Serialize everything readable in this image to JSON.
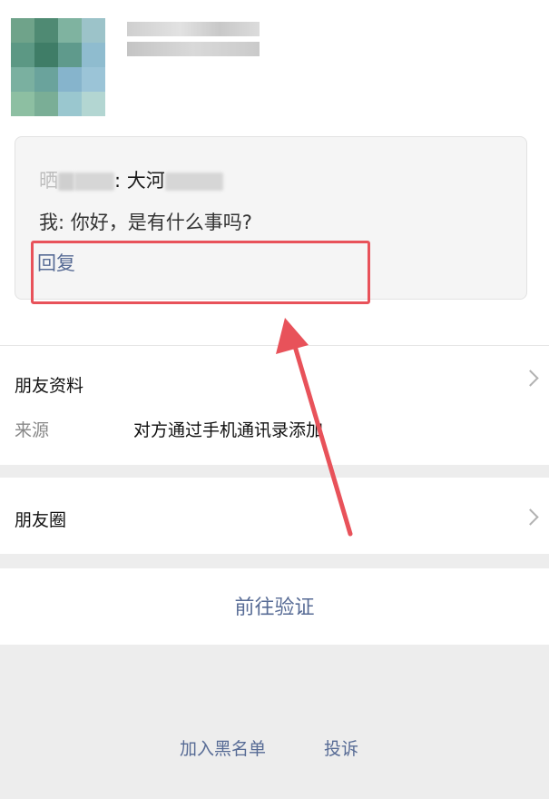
{
  "message": {
    "line1_prefix": "晒",
    "line1_name": "大河",
    "line2": "我: 你好，是有什么事吗?",
    "reply_label": "回复"
  },
  "friend_info": {
    "title": "朋友资料",
    "source_label": "来源",
    "source_value": "对方通过手机通讯录添加"
  },
  "moments": {
    "title": "朋友圈"
  },
  "actions": {
    "verify_label": "前往验证",
    "blacklist_label": "加入黑名单",
    "report_label": "投诉"
  },
  "colors": {
    "link": "#576b95",
    "highlight": "#e8525a",
    "background_gray": "#ededed"
  }
}
